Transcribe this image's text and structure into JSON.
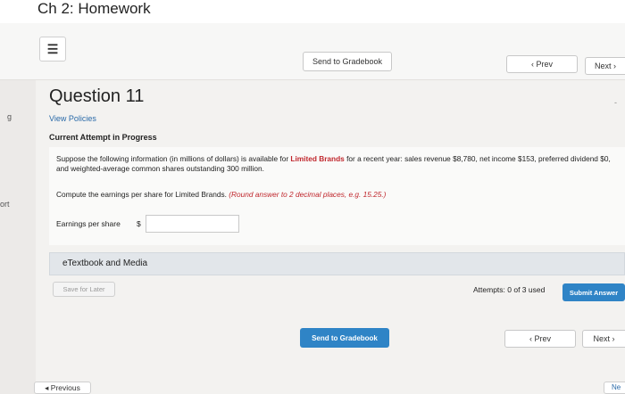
{
  "header": {
    "title": "Ch 2: Homework"
  },
  "toolbar": {
    "send_to_gradebook": "Send to Gradebook",
    "prev": "‹ Prev",
    "next": "Next ›"
  },
  "left_edge": {
    "text_1": "g",
    "text_2": "ort"
  },
  "question": {
    "title": "Question 11",
    "view_policies": "View Policies",
    "attempt_status": "Current Attempt in Progress",
    "text_part1": "Suppose the following information (in millions of dollars) is available for ",
    "company": "Limited Brands",
    "text_part2": " for a recent year: sales revenue $8,780, net income $153, preferred dividend $0, and weighted-average common shares outstanding 300 million.",
    "compute_text": "Compute the earnings per share for Limited Brands. ",
    "compute_hint": "(Round answer to 2 decimal places, e.g. 15.25.)",
    "eps_label": "Earnings per share",
    "currency_symbol": "$",
    "eps_value": ""
  },
  "etextbook": {
    "label": "eTextbook and Media"
  },
  "actions": {
    "save_for_later": "Save for Later",
    "attempts": "Attempts: 0 of 3 used",
    "submit": "Submit Answer"
  },
  "bottom_nav": {
    "send_to_gradebook": "Send to Gradebook",
    "prev": "‹ Prev",
    "next": "Next ›",
    "previous": "◂ Previous",
    "next_edge": "Ne"
  }
}
